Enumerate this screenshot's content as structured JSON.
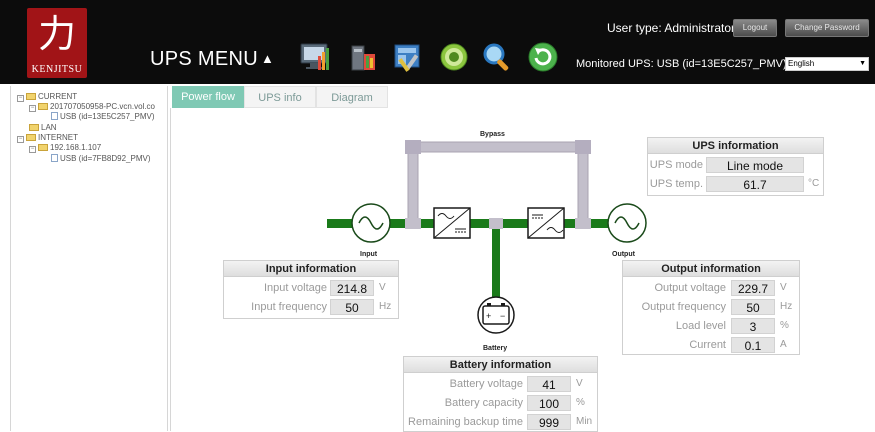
{
  "header": {
    "logo_glyph": "力",
    "logo_text": "KENJITSU",
    "menu_title": "UPS MENU",
    "menu_caret": "▲",
    "user_type": "User type: Administrator",
    "logout_label": "Logout",
    "change_password_label": "Change Password",
    "monitored_ups": "Monitored UPS: USB (id=13E5C257_PMV)",
    "language": "English",
    "toolbar_icons": [
      "monitor-chart-icon",
      "ups-battery-icon",
      "settings-tools-icon",
      "control-gear-icon",
      "search-icon",
      "refresh-icon"
    ]
  },
  "tree": {
    "current_label": "CURRENT",
    "pc_label": "201707050958-PC.vcn.vol.co",
    "usb_current_label": "USB (id=13E5C257_PMV)",
    "lan_label": "LAN",
    "internet_label": "INTERNET",
    "ip_label": "192.168.1.107",
    "usb_internet_label": "USB (id=7FB8D92_PMV)"
  },
  "tabs": [
    {
      "label": "Power flow",
      "active": true
    },
    {
      "label": "UPS info",
      "active": false
    },
    {
      "label": "Diagram",
      "active": false
    }
  ],
  "flow": {
    "bypass_label": "Bypass",
    "input_label": "Input",
    "output_label": "Output",
    "battery_label": "Battery",
    "active_color": "#1a7a1a",
    "inactive_color": "#c3bfcb"
  },
  "ups_information": {
    "title": "UPS information",
    "mode_label": "UPS mode",
    "mode_value": "Line mode",
    "temp_label": "UPS temp.",
    "temp_value": "61.7",
    "temp_unit": "°C"
  },
  "input_information": {
    "title": "Input information",
    "voltage_label": "Input voltage",
    "voltage_value": "214.8",
    "voltage_unit": "V",
    "frequency_label": "Input frequency",
    "frequency_value": "50",
    "frequency_unit": "Hz"
  },
  "output_information": {
    "title": "Output information",
    "voltage_label": "Output voltage",
    "voltage_value": "229.7",
    "voltage_unit": "V",
    "frequency_label": "Output frequency",
    "frequency_value": "50",
    "frequency_unit": "Hz",
    "load_label": "Load level",
    "load_value": "3",
    "load_unit": "%",
    "current_label": "Current",
    "current_value": "0.1",
    "current_unit": "A"
  },
  "battery_information": {
    "title": "Battery information",
    "voltage_label": "Battery voltage",
    "voltage_value": "41",
    "voltage_unit": "V",
    "capacity_label": "Battery capacity",
    "capacity_value": "100",
    "capacity_unit": "%",
    "backup_label": "Remaining backup time",
    "backup_value": "999",
    "backup_unit": "Min"
  }
}
